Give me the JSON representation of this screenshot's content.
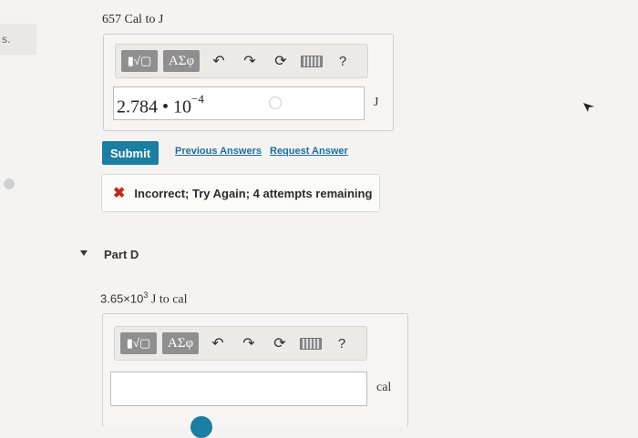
{
  "gutter": {
    "label": "s."
  },
  "part_c": {
    "question": "657 Cal to J",
    "toolbar": {
      "templates_label": "▮√▢",
      "greek_label": "ΑΣφ",
      "help_label": "?"
    },
    "answer_value": "2.784 • 10",
    "answer_exponent": "−4",
    "unit": "J",
    "submit_label": "Submit",
    "previous_answers_label": "Previous Answers",
    "request_answer_label": "Request Answer",
    "feedback": "Incorrect; Try Again; 4 attempts remaining"
  },
  "part_d": {
    "title": "Part D",
    "question_prefix": "3.65×10",
    "question_exponent": "3",
    "question_suffix": " J to cal",
    "toolbar": {
      "templates_label": "▮√▢",
      "greek_label": "ΑΣφ",
      "help_label": "?"
    },
    "answer_value": "",
    "unit": "cal"
  },
  "colors": {
    "submit": "#1b7ea3",
    "link": "#1b6ea0",
    "incorrect": "#c6281c"
  }
}
